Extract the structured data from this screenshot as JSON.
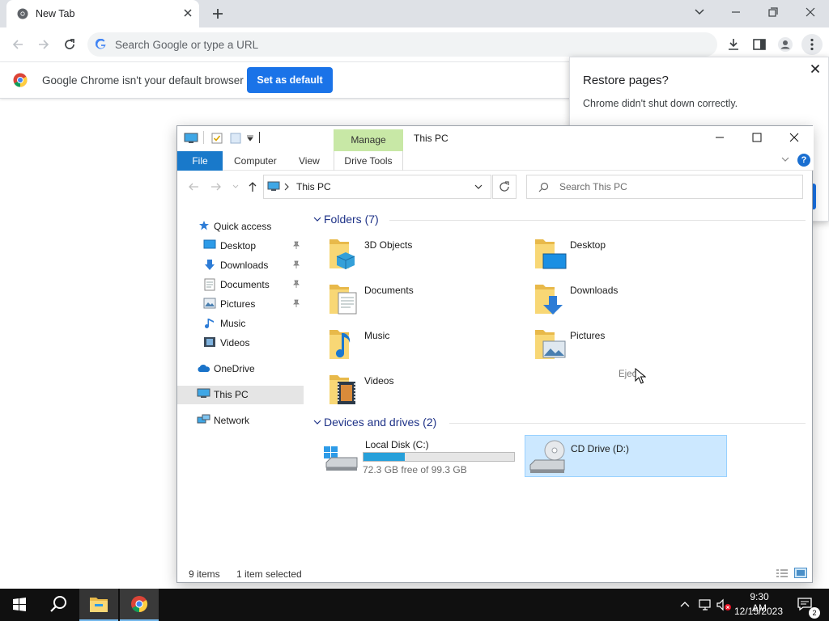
{
  "browser": {
    "tab": {
      "title": "New Tab"
    },
    "omnibox": {
      "placeholder": "Search Google or type a URL"
    },
    "infobar": {
      "message": "Google Chrome isn't your default browser",
      "button": "Set as default"
    },
    "restore": {
      "title": "Restore pages?",
      "message": "Chrome didn't shut down correctly."
    },
    "colors": {
      "accent": "#1a73e8",
      "tabstrip": "#dee1e6"
    }
  },
  "explorer": {
    "title": "This PC",
    "contextual_tab": "Manage",
    "ribbon_tabs": {
      "file": "File",
      "computer": "Computer",
      "view": "View",
      "drive_tools": "Drive Tools"
    },
    "address": "This PC",
    "search_placeholder": "Search This PC",
    "nav": {
      "quick_access": "Quick access",
      "desktop": "Desktop",
      "downloads": "Downloads",
      "documents": "Documents",
      "pictures": "Pictures",
      "music": "Music",
      "videos": "Videos",
      "onedrive": "OneDrive",
      "this_pc": "This PC",
      "network": "Network"
    },
    "folders_header": "Folders (7)",
    "folders": {
      "objects3d": "3D Objects",
      "desktop": "Desktop",
      "documents": "Documents",
      "downloads": "Downloads",
      "music": "Music",
      "pictures": "Pictures",
      "videos": "Videos"
    },
    "devices_header": "Devices and drives (2)",
    "drives": {
      "c": {
        "name": "Local Disk (C:)",
        "free_text": "72.3 GB free of 99.3 GB",
        "used_fraction": 0.272
      },
      "d": {
        "name": "CD Drive (D:)"
      }
    },
    "eject_label": "Ejec",
    "status": {
      "items": "9 items",
      "selected": "1 item selected"
    }
  },
  "taskbar": {
    "time": "9:30 AM",
    "date": "12/15/2023",
    "notifications": "2"
  }
}
